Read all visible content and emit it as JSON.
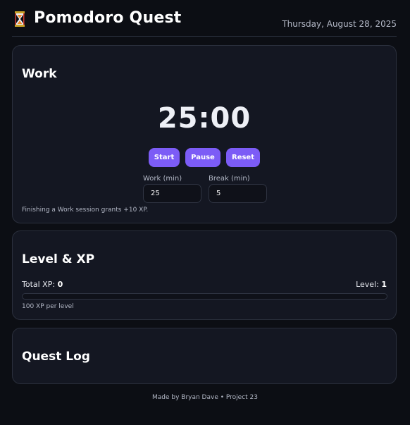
{
  "header": {
    "title": "Pomodoro Quest",
    "date": "Thursday, August 28, 2025",
    "icon": "hourglass-icon"
  },
  "timer_card": {
    "heading": "Work",
    "time": "25:00",
    "buttons": {
      "start": "Start",
      "pause": "Pause",
      "reset": "Reset"
    },
    "work_label": "Work (min)",
    "work_value": "25",
    "break_label": "Break (min)",
    "break_value": "5",
    "hint": "Finishing a Work session grants +10 XP."
  },
  "xp_card": {
    "heading": "Level & XP",
    "total_label": "Total XP:",
    "total_value": "0",
    "level_label": "Level:",
    "level_value": "1",
    "progress_fraction": 0,
    "hint": "100 XP per level"
  },
  "quest_card": {
    "heading": "Quest Log"
  },
  "footer": "Made by Bryan Dave • Project 23",
  "colors": {
    "background": "#0c0e14",
    "card": "#141722",
    "accent": "#7c5cf6"
  }
}
